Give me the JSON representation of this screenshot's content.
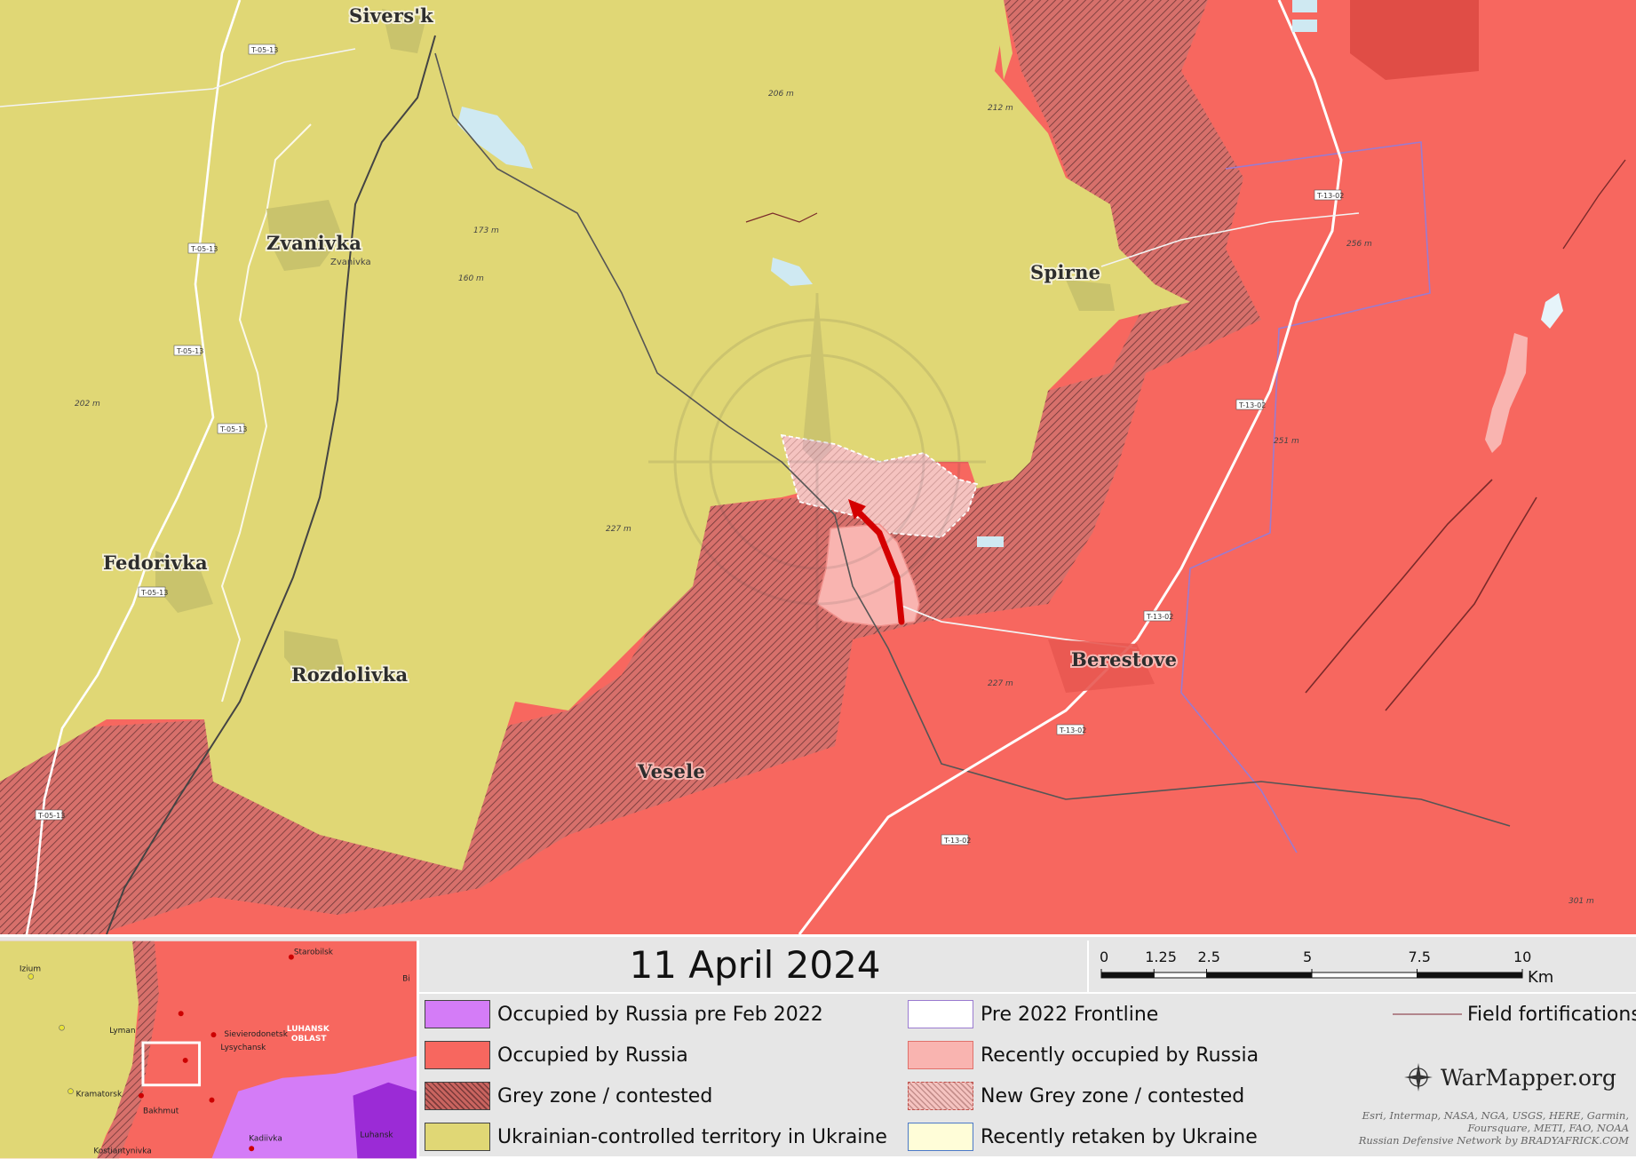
{
  "title": "11 April 2024",
  "scale_bar": {
    "ticks": [
      "0",
      "1.25",
      "2.5",
      "5",
      "7.5",
      "10"
    ],
    "unit": "Km"
  },
  "places": {
    "siversk": "Sivers'k",
    "zvanivka": "Zvanivka",
    "zvanivka_small": "Zvanivka",
    "spirne": "Spirne",
    "fedorivka": "Fedorivka",
    "rozdolivka": "Rozdolivka",
    "berestove": "Berestove",
    "vesele": "Vesele"
  },
  "road_labels": {
    "t0513": "T-05-13",
    "t1302": "T-13-02"
  },
  "elevations": {
    "e206": "206 m",
    "e212": "212 m",
    "e173": "173 m",
    "e160": "160 m",
    "e202": "202 m",
    "e227": "227 m",
    "e256": "256 m",
    "e251": "251 m",
    "e301": "301 m"
  },
  "legend": {
    "occupied_pre2022": "Occupied by Russia pre Feb 2022",
    "occupied": "Occupied by Russia",
    "grey_zone": "Grey zone / contested",
    "ukrainian": "Ukrainian-controlled territory in Ukraine",
    "pre2022_frontline": "Pre 2022 Frontline",
    "recently_occupied": "Recently occupied by Russia",
    "new_grey_zone": "New Grey zone / contested",
    "recently_retaken": "Recently retaken by Ukraine",
    "field_fortifications": "Field fortifications"
  },
  "inset": {
    "izium": "Izium",
    "lyman": "Lyman",
    "kramatorsk": "Kramatorsk",
    "bakhmut": "Bakhmut",
    "kostiantynivka": "Kostiantynivka",
    "starobilsk": "Starobilsk",
    "sievierodonetsk": "Sievierodonetsk",
    "lysychansk": "Lysychansk",
    "luhansk_oblast_1": "LUHANSK",
    "luhansk_oblast_2": "OBLAST",
    "kadiivka": "Kadiivka",
    "luhansk": "Luhansk",
    "bi": "Bi"
  },
  "brand": "WarMapper.org",
  "attribution": [
    "Esri, Intermap, NASA, NGA, USGS, HERE, Garmin,",
    "Foursquare, METI, FAO, NOAA",
    "Russian Defensive Network by BRADYAFRICK.COM"
  ],
  "colors": {
    "ukraine": "#e0d775",
    "russia": "#f7675f",
    "russia_pre2022": "#d47cf7",
    "grey_zone": "#c9645f",
    "recent_russia": "#f9b4b0",
    "recent_ukraine": "#fffdd8",
    "advance_arrow": "#d40000",
    "frontline_pre2022": "#9a7bd0"
  },
  "icons": [
    "compass-rose-icon",
    "advance-arrow-icon"
  ]
}
